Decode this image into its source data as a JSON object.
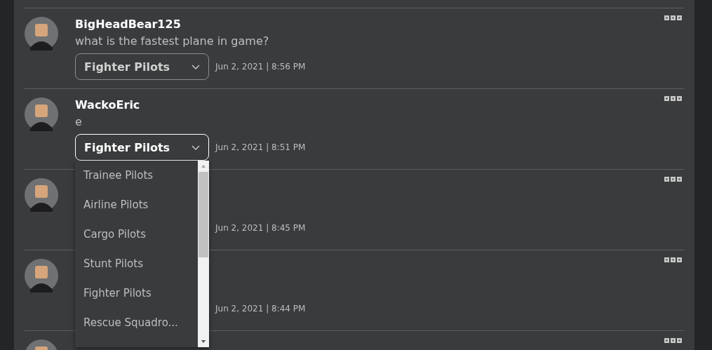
{
  "posts": [
    {
      "author": "BigHeadBear125",
      "message": "what is the fastest plane in game?",
      "select": {
        "value": "Fighter Pilots",
        "open": false
      },
      "timestamp": "Jun 2, 2021 | 8:56 PM",
      "more_options": true
    },
    {
      "author": "WackoEric",
      "message": "e",
      "select": {
        "value": "Fighter Pilots",
        "open": true,
        "options": [
          "Trainee Pilots",
          "Airline Pilots",
          "Cargo Pilots",
          "Stunt Pilots",
          "Fighter Pilots",
          "Rescue Squadro..."
        ]
      },
      "timestamp": "Jun 2, 2021 | 8:51 PM",
      "more_options": true
    },
    {
      "timestamp": "Jun 2, 2021 | 8:45 PM",
      "more_options": true
    },
    {
      "timestamp": "Jun 2, 2021 | 8:44 PM",
      "more_options": true
    },
    {
      "more_options": true
    }
  ]
}
